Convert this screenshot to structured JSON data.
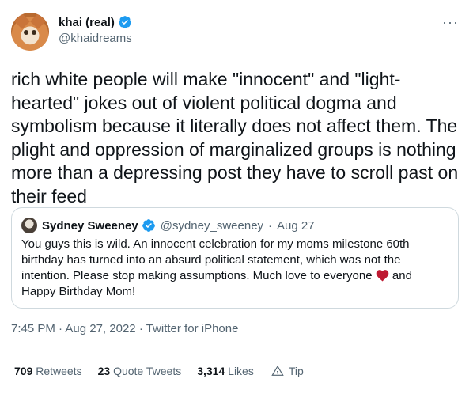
{
  "author": {
    "display_name": "khai (real)",
    "handle": "@khaidreams"
  },
  "tweet": {
    "text": "rich white people will make \"innocent\" and \"light-hearted\" jokes out of violent political dogma and symbolism because it literally does not affect them. The plight and oppression of marginalized groups is nothing more than a depressing post they have to scroll past on their feed"
  },
  "quote": {
    "display_name": "Sydney Sweeney",
    "handle": "@sydney_sweeney",
    "separator": "·",
    "date": "Aug 27",
    "text_before_heart": "You guys this is wild. An innocent celebration for my moms milestone 60th birthday has turned into an absurd political statement, which was not the intention. Please stop making assumptions. Much love to everyone ",
    "text_after_heart": " and Happy Birthday Mom!"
  },
  "timestamp": {
    "time": "7:45 PM",
    "separator": "·",
    "date": "Aug 27, 2022",
    "source": "Twitter for iPhone"
  },
  "stats": {
    "retweets_count": "709",
    "retweets_label": "Retweets",
    "quotes_count": "23",
    "quotes_label": "Quote Tweets",
    "likes_count": "3,314",
    "likes_label": "Likes",
    "tip_label": "Tip"
  },
  "colors": {
    "verified": "#1d9bf0",
    "heart": "#be1931",
    "secondary_text": "#536471"
  }
}
